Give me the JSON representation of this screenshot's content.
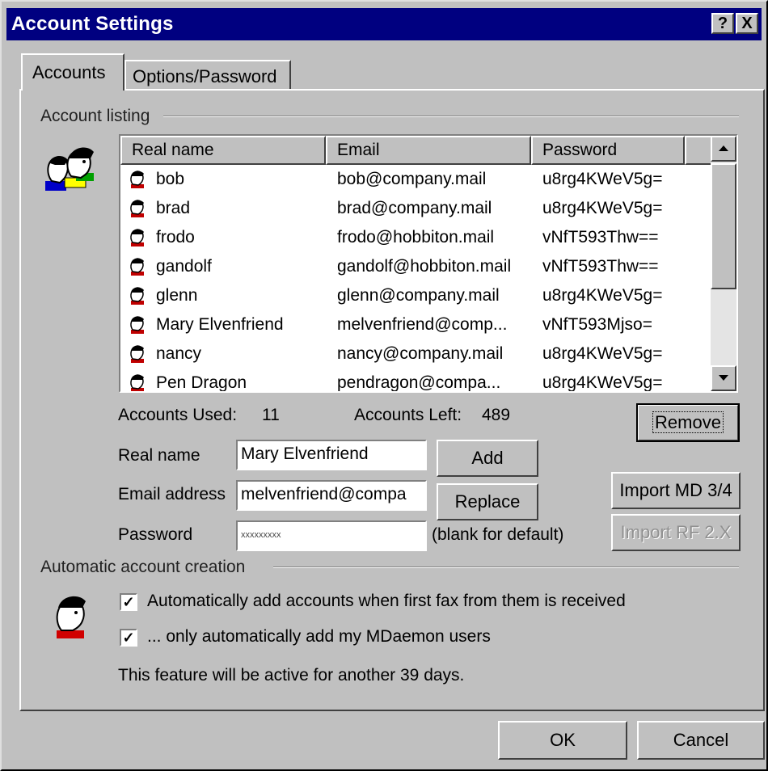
{
  "window": {
    "title": "Account Settings",
    "help_label": "?",
    "close_label": "X"
  },
  "tabs": [
    {
      "label": "Accounts"
    },
    {
      "label": "Options/Password"
    }
  ],
  "account_listing": {
    "group_label": "Account listing",
    "columns": [
      "Real name",
      "Email",
      "Password"
    ],
    "rows": [
      {
        "name": "bob",
        "email": "bob@company.mail",
        "password": "u8rg4KWeV5g="
      },
      {
        "name": "brad",
        "email": "brad@company.mail",
        "password": "u8rg4KWeV5g="
      },
      {
        "name": "frodo",
        "email": "frodo@hobbiton.mail",
        "password": "vNfT593Thw=="
      },
      {
        "name": "gandolf",
        "email": "gandolf@hobbiton.mail",
        "password": "vNfT593Thw=="
      },
      {
        "name": "glenn",
        "email": "glenn@company.mail",
        "password": "u8rg4KWeV5g="
      },
      {
        "name": "Mary Elvenfriend",
        "email": "melvenfriend@comp...",
        "password": "vNfT593Mjso="
      },
      {
        "name": "nancy",
        "email": "nancy@company.mail",
        "password": "u8rg4KWeV5g="
      },
      {
        "name": "Pen Dragon",
        "email": "pendragon@compa...",
        "password": "u8rg4KWeV5g="
      }
    ]
  },
  "stats": {
    "used_label": "Accounts Used:",
    "used_value": "11",
    "left_label": "Accounts Left:",
    "left_value": "489"
  },
  "form": {
    "real_name_label": "Real name",
    "real_name_value": "Mary Elvenfriend",
    "email_label": "Email address",
    "email_value": "melvenfriend@compa",
    "password_label": "Password",
    "password_value": "xxxxxxxxx",
    "password_hint": "(blank for default)"
  },
  "buttons": {
    "remove": "Remove",
    "add": "Add",
    "replace": "Replace",
    "import_md": "Import MD 3/4",
    "import_rf": "Import RF 2.X",
    "ok": "OK",
    "cancel": "Cancel"
  },
  "auto_creation": {
    "group_label": "Automatic account creation",
    "check1_label": "Automatically add accounts when first fax from them is received",
    "check1_checked": true,
    "check2_label": "... only automatically add my MDaemon users",
    "check2_checked": true,
    "notice": "This feature will be active for another 39 days."
  },
  "icons": {
    "users": "users-group-icon",
    "person": "person-icon",
    "row": "user-row-icon"
  },
  "colors": {
    "titlebar": "#000080",
    "face": "#c0c0c0"
  }
}
